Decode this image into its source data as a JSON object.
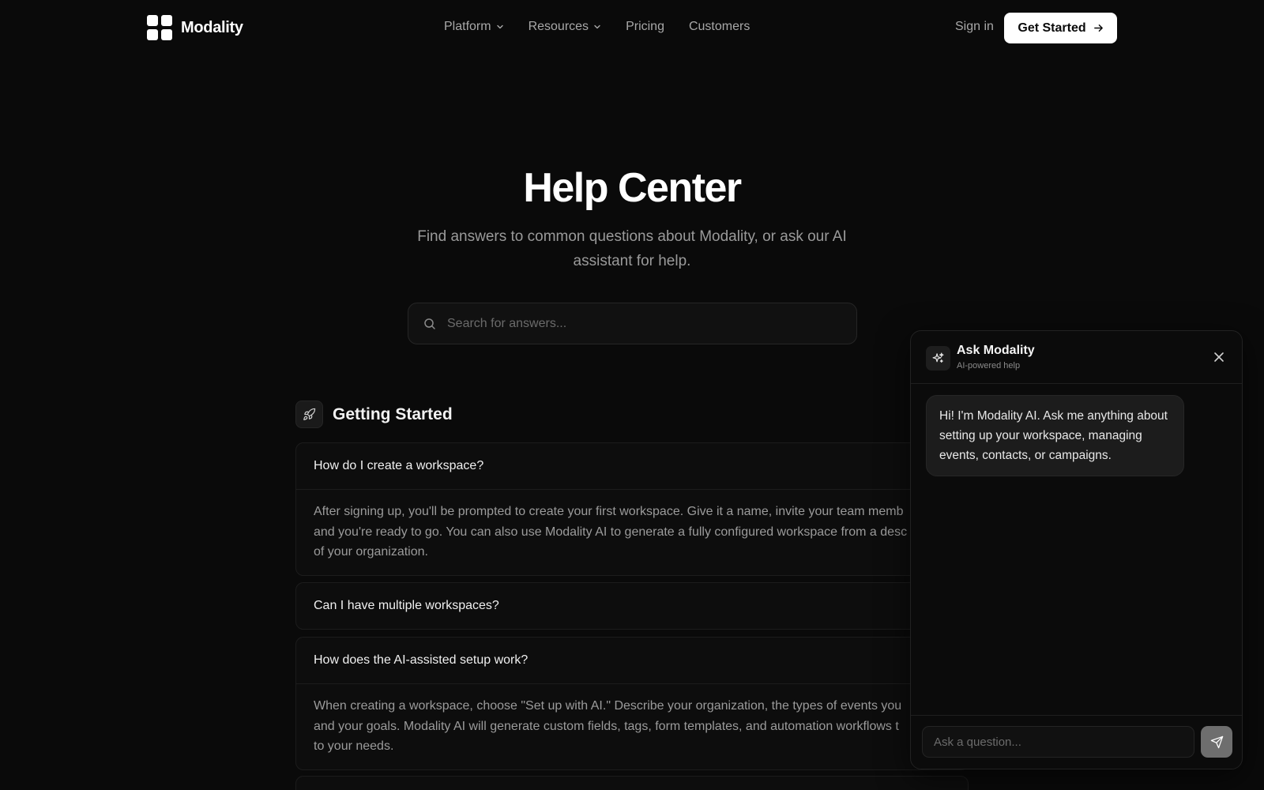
{
  "colors": {
    "background": "#0a0a0a",
    "primary_button": "#ffffff",
    "text_muted": "#9a9a9a"
  },
  "nav": {
    "brand": "Modality",
    "links": [
      {
        "label": "Platform",
        "has_dropdown": true
      },
      {
        "label": "Resources",
        "has_dropdown": true
      },
      {
        "label": "Pricing",
        "has_dropdown": false
      },
      {
        "label": "Customers",
        "has_dropdown": false
      }
    ],
    "signin_label": "Sign in",
    "cta_label": "Get Started"
  },
  "hero": {
    "title": "Help Center",
    "subtitle": "Find answers to common questions about Modality, or ask our AI assistant for help.",
    "search_placeholder": "Search for answers..."
  },
  "section": {
    "icon": "rocket-icon",
    "title": "Getting Started",
    "faqs": [
      {
        "question": "How do I create a workspace?",
        "answer_lines": [
          "After signing up, you'll be prompted to create your first workspace. Give it a name, invite your team memb",
          "and you're ready to go. You can also use Modality AI to generate a fully configured workspace from a desc",
          "of your organization."
        ]
      },
      {
        "question": "Can I have multiple workspaces?"
      },
      {
        "question": "How does the AI-assisted setup work?",
        "answer_lines": [
          "When creating a workspace, choose \"Set up with AI.\" Describe your organization, the types of events you",
          "and your goals. Modality AI will generate custom fields, tags, form templates, and automation workflows t",
          "to your needs."
        ]
      }
    ]
  },
  "chat": {
    "title": "Ask Modality",
    "subtitle": "AI-powered help",
    "message": "Hi! I'm Modality AI. Ask me anything about setting up your workspace, managing events, contacts, or campaigns.",
    "input_placeholder": "Ask a question..."
  }
}
